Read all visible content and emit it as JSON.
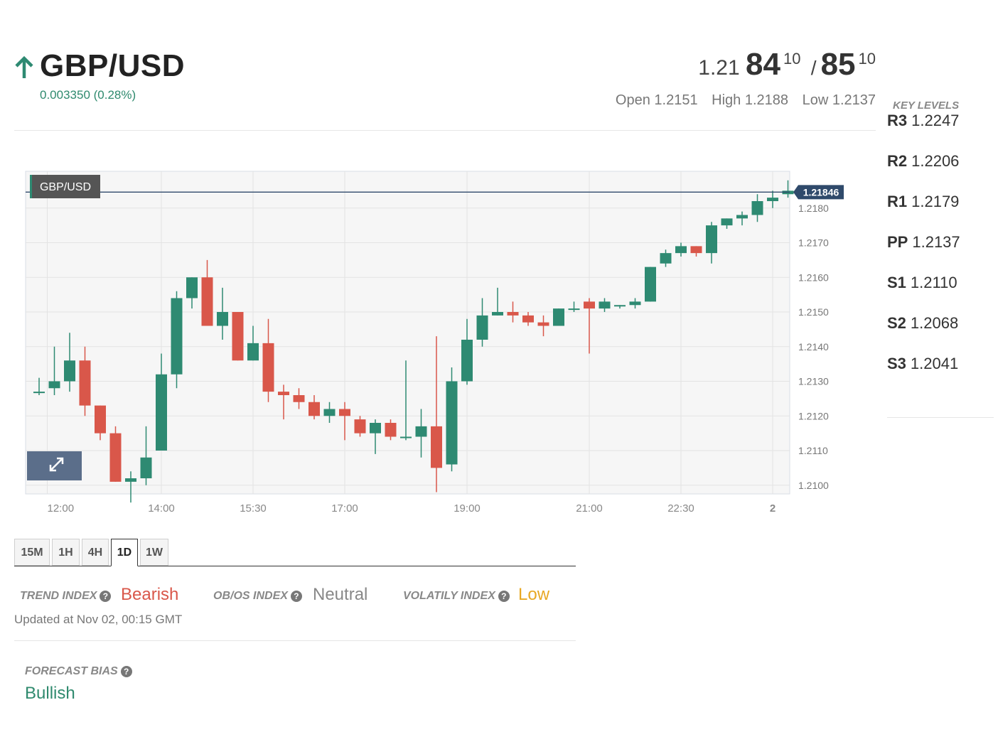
{
  "header": {
    "pair": "GBP/USD",
    "direction_icon": "arrow-up-icon",
    "change": "0.003350 (0.28%)",
    "bid_prefix": "1.21",
    "bid_big": "84",
    "bid_sup": "10",
    "slash": "/",
    "ask_big": "85",
    "ask_sup": "10",
    "open": "Open 1.2151",
    "high": "High 1.2188",
    "low": "Low 1.2137"
  },
  "key_levels": {
    "title": "KEY LEVELS",
    "items": [
      {
        "name": "R3",
        "value": "1.2247"
      },
      {
        "name": "R2",
        "value": "1.2206"
      },
      {
        "name": "R1",
        "value": "1.2179"
      },
      {
        "name": "PP",
        "value": "1.2137"
      },
      {
        "name": "S1",
        "value": "1.2110"
      },
      {
        "name": "S2",
        "value": "1.2068"
      },
      {
        "name": "S3",
        "value": "1.2041"
      }
    ]
  },
  "chart_data": {
    "type": "candlestick",
    "legend_label": "GBP/USD",
    "current_price_label": "1.21846",
    "current_price": 1.21846,
    "ylim": [
      1.2095,
      1.2188
    ],
    "y_ticks": [
      "1.2180",
      "1.2170",
      "1.2160",
      "1.2150",
      "1.2140",
      "1.2130",
      "1.2120",
      "1.2110",
      "1.2100"
    ],
    "x_ticks": [
      {
        "label": "12:00",
        "slot": 1
      },
      {
        "label": "14:00",
        "slot": 8
      },
      {
        "label": "15:30",
        "slot": 14
      },
      {
        "label": "17:00",
        "slot": 20
      },
      {
        "label": "19:00",
        "slot": 28
      },
      {
        "label": "21:00",
        "slot": 36
      },
      {
        "label": "22:30",
        "slot": 42
      },
      {
        "label": "2",
        "slot": 48
      }
    ],
    "candles": [
      {
        "o": 1.2127,
        "h": 1.2131,
        "l": 1.2126,
        "c": 1.2127
      },
      {
        "o": 1.2128,
        "h": 1.214,
        "l": 1.2126,
        "c": 1.213
      },
      {
        "o": 1.213,
        "h": 1.2144,
        "l": 1.2127,
        "c": 1.2136
      },
      {
        "o": 1.2136,
        "h": 1.214,
        "l": 1.212,
        "c": 1.2123
      },
      {
        "o": 1.2123,
        "h": 1.2123,
        "l": 1.2113,
        "c": 1.2115
      },
      {
        "o": 1.2115,
        "h": 1.2117,
        "l": 1.2101,
        "c": 1.2101
      },
      {
        "o": 1.2101,
        "h": 1.2104,
        "l": 1.2095,
        "c": 1.2102
      },
      {
        "o": 1.2102,
        "h": 1.2117,
        "l": 1.21,
        "c": 1.2108
      },
      {
        "o": 1.211,
        "h": 1.2138,
        "l": 1.211,
        "c": 1.2132
      },
      {
        "o": 1.2132,
        "h": 1.2156,
        "l": 1.2128,
        "c": 1.2154
      },
      {
        "o": 1.2154,
        "h": 1.216,
        "l": 1.2151,
        "c": 1.216
      },
      {
        "o": 1.216,
        "h": 1.2165,
        "l": 1.2146,
        "c": 1.2146
      },
      {
        "o": 1.2146,
        "h": 1.2157,
        "l": 1.2142,
        "c": 1.215
      },
      {
        "o": 1.215,
        "h": 1.215,
        "l": 1.2136,
        "c": 1.2136
      },
      {
        "o": 1.2136,
        "h": 1.2146,
        "l": 1.2136,
        "c": 1.2141
      },
      {
        "o": 1.2141,
        "h": 1.2148,
        "l": 1.2124,
        "c": 1.2127
      },
      {
        "o": 1.2127,
        "h": 1.2129,
        "l": 1.2119,
        "c": 1.2126
      },
      {
        "o": 1.2126,
        "h": 1.2128,
        "l": 1.2122,
        "c": 1.2124
      },
      {
        "o": 1.2124,
        "h": 1.2126,
        "l": 1.2119,
        "c": 1.212
      },
      {
        "o": 1.212,
        "h": 1.2124,
        "l": 1.2118,
        "c": 1.2122
      },
      {
        "o": 1.2122,
        "h": 1.2124,
        "l": 1.2113,
        "c": 1.212
      },
      {
        "o": 1.2119,
        "h": 1.212,
        "l": 1.2114,
        "c": 1.2115
      },
      {
        "o": 1.2115,
        "h": 1.2119,
        "l": 1.2109,
        "c": 1.2118
      },
      {
        "o": 1.2118,
        "h": 1.2119,
        "l": 1.2113,
        "c": 1.2114
      },
      {
        "o": 1.2114,
        "h": 1.2136,
        "l": 1.2113,
        "c": 1.2114
      },
      {
        "o": 1.2114,
        "h": 1.2122,
        "l": 1.2108,
        "c": 1.2117
      },
      {
        "o": 1.2117,
        "h": 1.2143,
        "l": 1.2098,
        "c": 1.2105
      },
      {
        "o": 1.2106,
        "h": 1.2134,
        "l": 1.2104,
        "c": 1.213
      },
      {
        "o": 1.213,
        "h": 1.2148,
        "l": 1.2129,
        "c": 1.2142
      },
      {
        "o": 1.2142,
        "h": 1.2154,
        "l": 1.214,
        "c": 1.2149
      },
      {
        "o": 1.2149,
        "h": 1.2157,
        "l": 1.2149,
        "c": 1.215
      },
      {
        "o": 1.215,
        "h": 1.2153,
        "l": 1.2147,
        "c": 1.2149
      },
      {
        "o": 1.2149,
        "h": 1.215,
        "l": 1.2146,
        "c": 1.2147
      },
      {
        "o": 1.2147,
        "h": 1.2149,
        "l": 1.2143,
        "c": 1.2146
      },
      {
        "o": 1.2146,
        "h": 1.2151,
        "l": 1.2146,
        "c": 1.2151
      },
      {
        "o": 1.2151,
        "h": 1.2153,
        "l": 1.215,
        "c": 1.2151
      },
      {
        "o": 1.2153,
        "h": 1.2154,
        "l": 1.2138,
        "c": 1.2151
      },
      {
        "o": 1.2151,
        "h": 1.2154,
        "l": 1.215,
        "c": 1.2153
      },
      {
        "o": 1.2152,
        "h": 1.2152,
        "l": 1.2151,
        "c": 1.2152
      },
      {
        "o": 1.2152,
        "h": 1.2154,
        "l": 1.2151,
        "c": 1.2153
      },
      {
        "o": 1.2153,
        "h": 1.2163,
        "l": 1.2153,
        "c": 1.2163
      },
      {
        "o": 1.2164,
        "h": 1.2168,
        "l": 1.2163,
        "c": 1.2167
      },
      {
        "o": 1.2167,
        "h": 1.217,
        "l": 1.2166,
        "c": 1.2169
      },
      {
        "o": 1.2169,
        "h": 1.2169,
        "l": 1.2166,
        "c": 1.2167
      },
      {
        "o": 1.2167,
        "h": 1.2176,
        "l": 1.2164,
        "c": 1.2175
      },
      {
        "o": 1.2175,
        "h": 1.2177,
        "l": 1.2174,
        "c": 1.2177
      },
      {
        "o": 1.2177,
        "h": 1.2179,
        "l": 1.2175,
        "c": 1.2178
      },
      {
        "o": 1.2178,
        "h": 1.2184,
        "l": 1.2176,
        "c": 1.2182
      },
      {
        "o": 1.2182,
        "h": 1.2185,
        "l": 1.218,
        "c": 1.2183
      },
      {
        "o": 1.2184,
        "h": 1.2188,
        "l": 1.2183,
        "c": 1.2185
      }
    ]
  },
  "timeframes": {
    "items": [
      "15M",
      "1H",
      "4H",
      "1D",
      "1W"
    ],
    "active": "1D"
  },
  "indicators": {
    "trend_label": "TREND INDEX",
    "trend_value": "Bearish",
    "obos_label": "OB/OS INDEX",
    "obos_value": "Neutral",
    "volatility_label": "VOLATILY INDEX",
    "volatility_value": "Low",
    "help_icon": "question-circle-icon",
    "updated": "Updated at Nov 02, 00:15 GMT",
    "forecast_label": "FORECAST BIAS",
    "forecast_value": "Bullish"
  },
  "colors": {
    "bullish": "#2e8a72",
    "bearish": "#d9574a",
    "bearish_text": "#d9574a",
    "neutral_text": "#888888",
    "low_text": "#e8a824",
    "price_tag": "#2f4a6b"
  }
}
